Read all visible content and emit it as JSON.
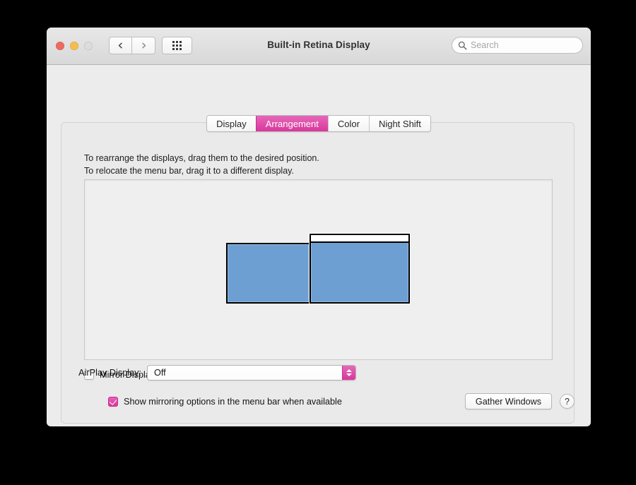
{
  "window": {
    "title": "Built-in Retina Display",
    "traffic_lights": [
      {
        "name": "close",
        "color": "#ee6a5f"
      },
      {
        "name": "minimize",
        "color": "#f5bd4f"
      },
      {
        "name": "zoom",
        "color": "#dcdcdc"
      }
    ],
    "nav": {
      "back_icon": "chevron-left-icon",
      "forward_icon": "chevron-right-icon"
    },
    "grid_button_icon": "grid-9-dots-icon"
  },
  "search": {
    "placeholder": "Search",
    "value": "",
    "icon": "search-icon"
  },
  "tabs": [
    {
      "label": "Display",
      "selected": false
    },
    {
      "label": "Arrangement",
      "selected": true
    },
    {
      "label": "Color",
      "selected": false
    },
    {
      "label": "Night Shift",
      "selected": false
    }
  ],
  "instructions": {
    "line1": "To rearrange the displays, drag them to the desired position.",
    "line2": "To relocate the menu bar, drag it to a different display."
  },
  "arrangement": {
    "displays": [
      {
        "name": "display-left",
        "has_menu_bar": false,
        "fill": "#6d9fd3"
      },
      {
        "name": "display-right",
        "has_menu_bar": true,
        "fill": "#6d9fd3"
      }
    ]
  },
  "mirror": {
    "label": "Mirror Displays",
    "checked": false
  },
  "airplay": {
    "label": "AirPlay Display:",
    "value": "Off",
    "options": [
      "Off"
    ],
    "accent": "#d8379c"
  },
  "mirroring_options": {
    "label": "Show mirroring options in the menu bar when available",
    "checked": true
  },
  "buttons": {
    "gather_windows": "Gather Windows",
    "help": "?"
  },
  "colors": {
    "accent_pink": "#d8379c",
    "display_blue": "#6d9fd3",
    "window_bg": "#ececec"
  }
}
